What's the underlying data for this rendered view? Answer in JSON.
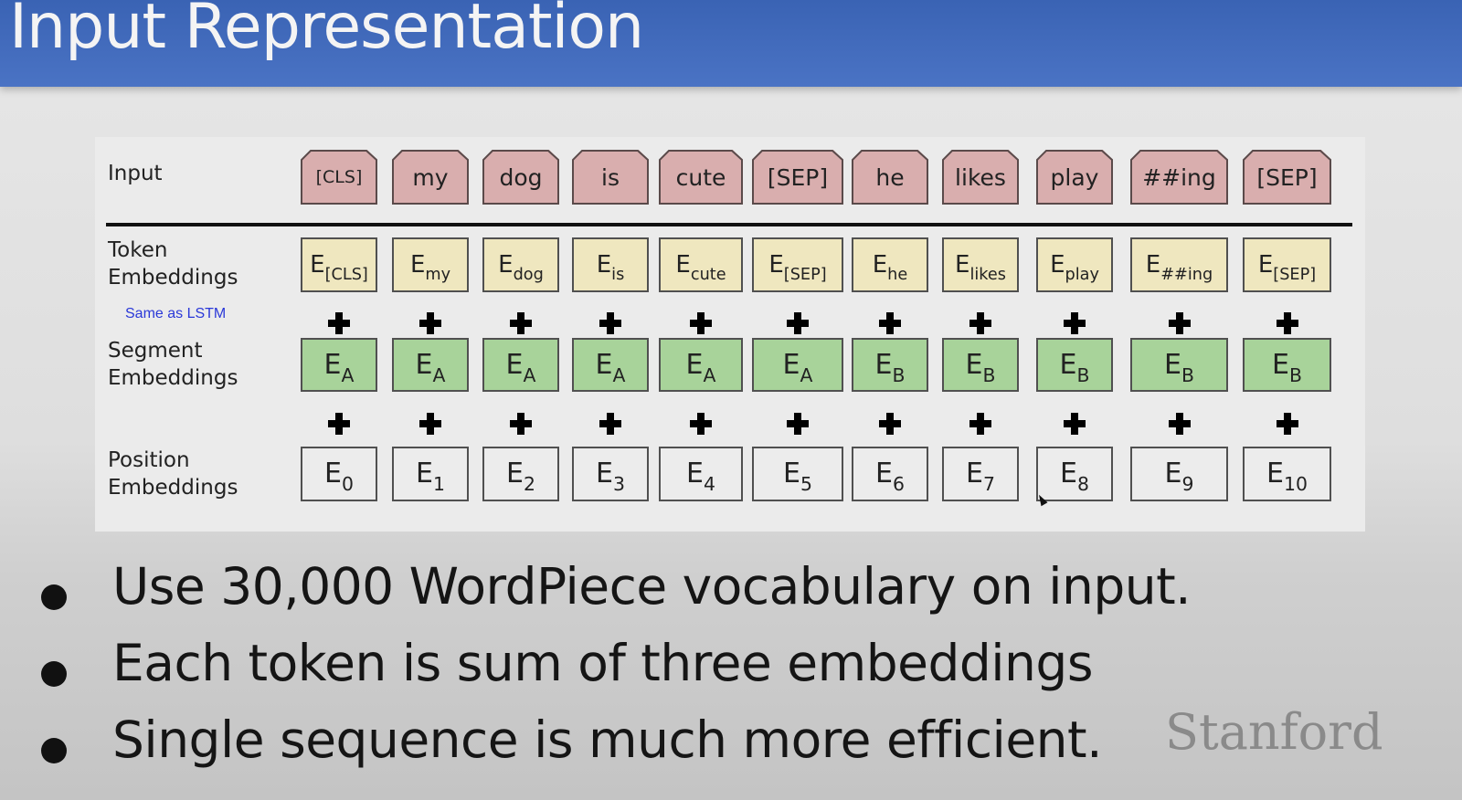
{
  "slide": {
    "title": "Input Representation"
  },
  "diagram": {
    "row_labels": {
      "input": "Input",
      "token": [
        "Token",
        "Embeddings"
      ],
      "segment": [
        "Segment",
        "Embeddings"
      ],
      "position": [
        "Position",
        "Embeddings"
      ]
    },
    "token_note": "Same as LSTM",
    "input_tokens": [
      "[CLS]",
      "my",
      "dog",
      "is",
      "cute",
      "[SEP]",
      "he",
      "likes",
      "play",
      "##ing",
      "[SEP]"
    ],
    "embedding_letter": "E",
    "token_embedding_subscripts": [
      "[CLS]",
      "my",
      "dog",
      "is",
      "cute",
      "[SEP]",
      "he",
      "likes",
      "play",
      "##ing",
      "[SEP]"
    ],
    "segment_embedding_subscripts": [
      "A",
      "A",
      "A",
      "A",
      "A",
      "A",
      "B",
      "B",
      "B",
      "B",
      "B"
    ],
    "position_embedding_subscripts": [
      "0",
      "1",
      "2",
      "3",
      "4",
      "5",
      "6",
      "7",
      "8",
      "9",
      "10"
    ],
    "colors": {
      "input": "#d9aeae",
      "token": "#efe7bf",
      "segment": "#a8d39a",
      "position": "#ececec"
    }
  },
  "bullets": [
    "Use 30,000 WordPiece vocabulary on input.",
    "Each token is sum of three embeddings",
    "Single sequence is much more efficient."
  ],
  "logo": "Stanford"
}
